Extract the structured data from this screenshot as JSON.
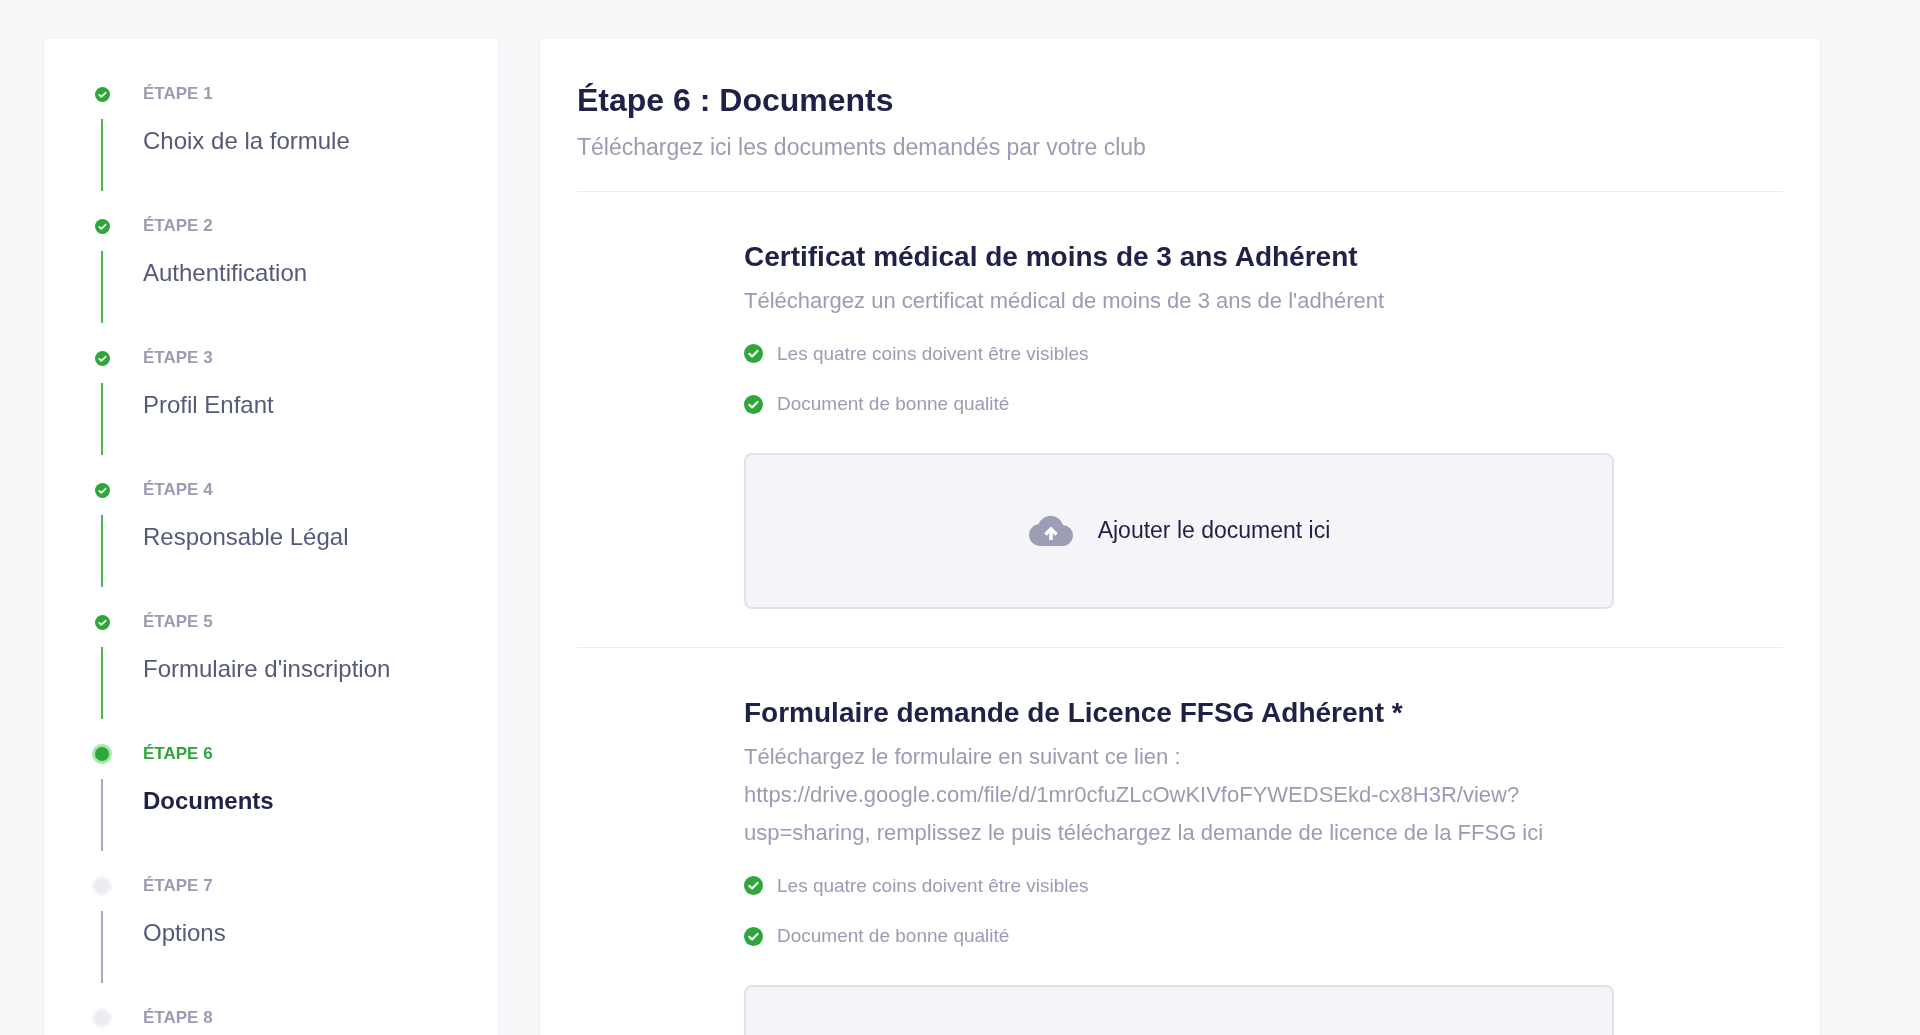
{
  "steps": [
    {
      "label": "ÉTAPE 1",
      "title": "Choix de la formule",
      "completed": true,
      "selected": false
    },
    {
      "label": "ÉTAPE 2",
      "title": "Authentification",
      "completed": true,
      "selected": false
    },
    {
      "label": "ÉTAPE 3",
      "title": "Profil Enfant",
      "completed": true,
      "selected": false
    },
    {
      "label": "ÉTAPE 4",
      "title": "Responsable Légal",
      "completed": true,
      "selected": false
    },
    {
      "label": "ÉTAPE 5",
      "title": "Formulaire d'inscription",
      "completed": true,
      "selected": false
    },
    {
      "label": "ÉTAPE 6",
      "title": "Documents",
      "completed": false,
      "selected": true
    },
    {
      "label": "ÉTAPE 7",
      "title": "Options",
      "completed": false,
      "selected": false
    },
    {
      "label": "ÉTAPE 8",
      "completed": false,
      "selected": false
    }
  ],
  "main": {
    "title": "Étape 6 : Documents",
    "subtitle": "Téléchargez ici les documents demandés par votre club",
    "documents": [
      {
        "title": "Certificat médical de moins de 3 ans Adhérent",
        "description": "Téléchargez un certificat médical de moins de 3 ans de l'adhérent",
        "requirements": [
          "Les quatre coins doivent être visibles",
          "Document de bonne qualité"
        ],
        "upload_label": "Ajouter le document ici"
      },
      {
        "title": "Formulaire demande de Licence FFSG Adhérent *",
        "description": "Téléchargez le formulaire en suivant ce lien : https://drive.google.com/file/d/1mr0cfuZLcOwKIVfoFYWEDSEkd-cx8H3R/view?usp=sharing, remplissez le puis téléchargez la demande de licence de la FFSG ici",
        "requirements": [
          "Les quatre coins doivent être visibles",
          "Document de bonne qualité"
        ]
      }
    ]
  }
}
